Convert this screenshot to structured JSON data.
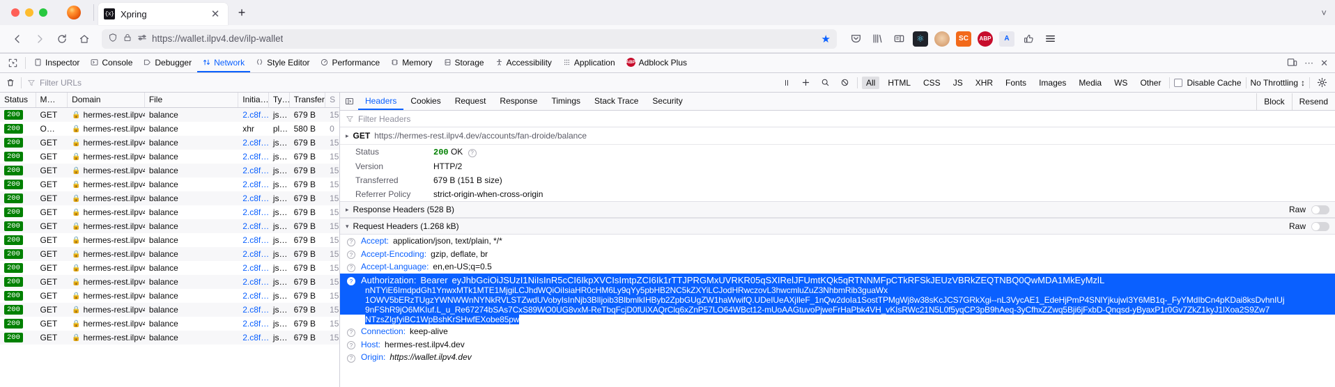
{
  "browser": {
    "tab": {
      "title": "Xpring",
      "favicon_text": "{x}",
      "close_icon": "close-icon"
    },
    "new_tab_label": "+",
    "url": {
      "scheme": "https://",
      "host": "wallet.ilpv4.dev",
      "path": "/ilp-wallet",
      "full": "https://wallet.ilpv4.dev/ilp-wallet"
    },
    "extensions": [
      {
        "name": "pocket-icon",
        "glyph": "♡"
      },
      {
        "name": "library-icon",
        "glyph": "||||\\"
      },
      {
        "name": "sidebar-icon",
        "glyph": "▤"
      },
      {
        "name": "react-devtools-icon",
        "glyph": "⚛"
      },
      {
        "name": "tampermonkey-icon",
        "glyph": ""
      },
      {
        "name": "screencastify-icon",
        "glyph": "SC"
      },
      {
        "name": "adblock-plus-icon",
        "glyph": "ABP"
      },
      {
        "name": "translate-icon",
        "glyph": "A"
      },
      {
        "name": "thumb-icon",
        "glyph": "👍"
      },
      {
        "name": "app-menu-icon",
        "glyph": "☰"
      }
    ]
  },
  "devtools": {
    "tabs": [
      {
        "label": "Inspector",
        "icon": "inspector-icon",
        "active": false
      },
      {
        "label": "Console",
        "icon": "console-icon",
        "active": false
      },
      {
        "label": "Debugger",
        "icon": "debugger-icon",
        "active": false
      },
      {
        "label": "Network",
        "icon": "network-icon",
        "active": true
      },
      {
        "label": "Style Editor",
        "icon": "style-editor-icon",
        "active": false
      },
      {
        "label": "Performance",
        "icon": "performance-icon",
        "active": false
      },
      {
        "label": "Memory",
        "icon": "memory-icon",
        "active": false
      },
      {
        "label": "Storage",
        "icon": "storage-icon",
        "active": false
      },
      {
        "label": "Accessibility",
        "icon": "accessibility-icon",
        "active": false
      },
      {
        "label": "Application",
        "icon": "application-icon",
        "active": false
      },
      {
        "label": "Adblock Plus",
        "icon": "adblock-plus-icon",
        "active": false
      }
    ],
    "accent_color": "#0a60ff",
    "status_color": "#008000"
  },
  "network_toolbar": {
    "clear_icon": "trash-icon",
    "filter_urls_placeholder": "Filter URLs",
    "pause_icon": "pause-icon",
    "add_icon": "plus-icon",
    "search_icon": "search-icon",
    "block_icon": "no-entry-icon",
    "filters": [
      {
        "label": "All",
        "active": true
      },
      {
        "label": "HTML",
        "active": false
      },
      {
        "label": "CSS",
        "active": false
      },
      {
        "label": "JS",
        "active": false
      },
      {
        "label": "XHR",
        "active": false
      },
      {
        "label": "Fonts",
        "active": false
      },
      {
        "label": "Images",
        "active": false
      },
      {
        "label": "Media",
        "active": false
      },
      {
        "label": "WS",
        "active": false
      },
      {
        "label": "Other",
        "active": false
      }
    ],
    "disable_cache_label": "Disable Cache",
    "disable_cache_checked": false,
    "throttling_label": "No Throttling",
    "settings_icon": "gear-icon"
  },
  "request_list": {
    "columns": [
      "Status",
      "M…",
      "Domain",
      "File",
      "Initia…",
      "Ty…",
      "Transfer…",
      "S"
    ],
    "rows": [
      {
        "status": "200",
        "method": "GET",
        "domain": "hermes-rest.ilpv4.d…",
        "file": "balance",
        "initiator": "2.c8f…",
        "initiator_link": true,
        "type": "js…",
        "transferred": "679 B",
        "size": "15"
      },
      {
        "status": "200",
        "method": "O…",
        "domain": "hermes-rest.ilpv4.d…",
        "file": "balance",
        "initiator": "xhr",
        "initiator_link": false,
        "type": "pl…",
        "transferred": "580 B",
        "size": "0"
      },
      {
        "status": "200",
        "method": "GET",
        "domain": "hermes-rest.ilpv4.d…",
        "file": "balance",
        "initiator": "2.c8f…",
        "initiator_link": true,
        "type": "js…",
        "transferred": "679 B",
        "size": "15"
      },
      {
        "status": "200",
        "method": "GET",
        "domain": "hermes-rest.ilpv4.d…",
        "file": "balance",
        "initiator": "2.c8f…",
        "initiator_link": true,
        "type": "js…",
        "transferred": "679 B",
        "size": "15"
      },
      {
        "status": "200",
        "method": "GET",
        "domain": "hermes-rest.ilpv4.d…",
        "file": "balance",
        "initiator": "2.c8f…",
        "initiator_link": true,
        "type": "js…",
        "transferred": "679 B",
        "size": "15"
      },
      {
        "status": "200",
        "method": "GET",
        "domain": "hermes-rest.ilpv4.d…",
        "file": "balance",
        "initiator": "2.c8f…",
        "initiator_link": true,
        "type": "js…",
        "transferred": "679 B",
        "size": "15"
      },
      {
        "status": "200",
        "method": "GET",
        "domain": "hermes-rest.ilpv4.d…",
        "file": "balance",
        "initiator": "2.c8f…",
        "initiator_link": true,
        "type": "js…",
        "transferred": "679 B",
        "size": "15"
      },
      {
        "status": "200",
        "method": "GET",
        "domain": "hermes-rest.ilpv4.d…",
        "file": "balance",
        "initiator": "2.c8f…",
        "initiator_link": true,
        "type": "js…",
        "transferred": "679 B",
        "size": "15"
      },
      {
        "status": "200",
        "method": "GET",
        "domain": "hermes-rest.ilpv4.d…",
        "file": "balance",
        "initiator": "2.c8f…",
        "initiator_link": true,
        "type": "js…",
        "transferred": "679 B",
        "size": "15"
      },
      {
        "status": "200",
        "method": "GET",
        "domain": "hermes-rest.ilpv4.d…",
        "file": "balance",
        "initiator": "2.c8f…",
        "initiator_link": true,
        "type": "js…",
        "transferred": "679 B",
        "size": "15"
      },
      {
        "status": "200",
        "method": "GET",
        "domain": "hermes-rest.ilpv4.d…",
        "file": "balance",
        "initiator": "2.c8f…",
        "initiator_link": true,
        "type": "js…",
        "transferred": "679 B",
        "size": "15"
      },
      {
        "status": "200",
        "method": "GET",
        "domain": "hermes-rest.ilpv4.d…",
        "file": "balance",
        "initiator": "2.c8f…",
        "initiator_link": true,
        "type": "js…",
        "transferred": "679 B",
        "size": "15"
      },
      {
        "status": "200",
        "method": "GET",
        "domain": "hermes-rest.ilpv4.d…",
        "file": "balance",
        "initiator": "2.c8f…",
        "initiator_link": true,
        "type": "js…",
        "transferred": "679 B",
        "size": "15"
      },
      {
        "status": "200",
        "method": "GET",
        "domain": "hermes-rest.ilpv4.d…",
        "file": "balance",
        "initiator": "2.c8f…",
        "initiator_link": true,
        "type": "js…",
        "transferred": "679 B",
        "size": "15"
      },
      {
        "status": "200",
        "method": "GET",
        "domain": "hermes-rest.ilpv4.d…",
        "file": "balance",
        "initiator": "2.c8f…",
        "initiator_link": true,
        "type": "js…",
        "transferred": "679 B",
        "size": "15"
      },
      {
        "status": "200",
        "method": "GET",
        "domain": "hermes-rest.ilpv4.d…",
        "file": "balance",
        "initiator": "2.c8f…",
        "initiator_link": true,
        "type": "js…",
        "transferred": "679 B",
        "size": "15"
      },
      {
        "status": "200",
        "method": "GET",
        "domain": "hermes-rest.ilpv4.d…",
        "file": "balance",
        "initiator": "2.c8f…",
        "initiator_link": true,
        "type": "js…",
        "transferred": "679 B",
        "size": "15"
      }
    ]
  },
  "detail": {
    "tabs": [
      {
        "label": "Headers",
        "active": true
      },
      {
        "label": "Cookies",
        "active": false
      },
      {
        "label": "Request",
        "active": false
      },
      {
        "label": "Response",
        "active": false
      },
      {
        "label": "Timings",
        "active": false
      },
      {
        "label": "Stack Trace",
        "active": false
      },
      {
        "label": "Security",
        "active": false
      }
    ],
    "block_label": "Block",
    "resend_label": "Resend",
    "filter_headers_placeholder": "Filter Headers",
    "request_method": "GET",
    "request_url": "https://hermes-rest.ilpv4.dev/accounts/fan-droide/balance",
    "summary": [
      {
        "key": "Status",
        "value": "200 OK",
        "is_status": true
      },
      {
        "key": "Version",
        "value": "HTTP/2",
        "is_status": false
      },
      {
        "key": "Transferred",
        "value": "679 B (151 B size)",
        "is_status": false
      },
      {
        "key": "Referrer Policy",
        "value": "strict-origin-when-cross-origin",
        "is_status": false
      }
    ],
    "response_headers_section": "Response Headers (528 B)",
    "request_headers_section": "Request Headers (1.268 kB)",
    "raw_label": "Raw",
    "request_headers": [
      {
        "name": "Accept:",
        "value": "application/json, text/plain, */*",
        "italic": false
      },
      {
        "name": "Accept-Encoding:",
        "value": "gzip, deflate, br",
        "italic": false
      },
      {
        "name": "Accept-Language:",
        "value": "en,en-US;q=0.5",
        "italic": false
      }
    ],
    "authorization": {
      "name": "Authorization:",
      "scheme": "Bearer",
      "token_lines": [
        "eyJhbGciOiJSUzI1NiIsInR5cCI6IkpXVCIsImtpZCI6Ik1rTTJPRGMxUVRKR05qSXIRelJFUmtKQk5qRTNNMFpCTkRFSkJEUzVBRkZEQTNBQ0QwMDA1MkEyMzlL",
        "nNTYiE6ImdpdGh1YnwxMTk1MTE1MjgiLCJhdWQiOiIsiaHR0cHM6Ly9qYy5pbHB2NC5kZXYiLCJodHRwczovL3hwcmluZuZ3NhbmRib3guaWx",
        "1OWV5bERzTUgzYWNWWnNYNkRVLSTZwdUVobyIsInNjb3BlIjoib3BlbmlkIHByb2ZpbGUgZW1haWwifQ.UDeIUeAXjIleF_1nQw2doIa1SostTPMgWj8w38sKcJCS7GRkXgi--nL3VycAE1_EdeHjPmP4SNlYjkujwI3Y6MB1q-_FyYMdIbCn4pKDai8ksDvhnIUj",
        "9nFShR9jO6MKIuf.L_u_Re67274bSAs7CxS89WO0UG8vxM-ReTbqFcjD0fUiXAQrClq6xZnP57LO64WBct12-mUoAAGtuvoPjweFrHaPbk4VH_vKIsRWc21N5L0f5yqCP3pB9hAeq-3yCfhxZZwq5Bji6jFxbD-Qnqsd-yByaxP1r0Gv7ZkZ1kyJ1lXoa2S9Zw7",
        "NTzsZIgfyiBC1WpBshKrSHwfEXobe85pw"
      ]
    },
    "trailing_headers": [
      {
        "name": "Connection:",
        "value": "keep-alive",
        "italic": false
      },
      {
        "name": "Host:",
        "value": "hermes-rest.ilpv4.dev",
        "italic": false
      },
      {
        "name": "Origin:",
        "value": "https://wallet.ilpv4.dev",
        "italic": true
      }
    ]
  }
}
